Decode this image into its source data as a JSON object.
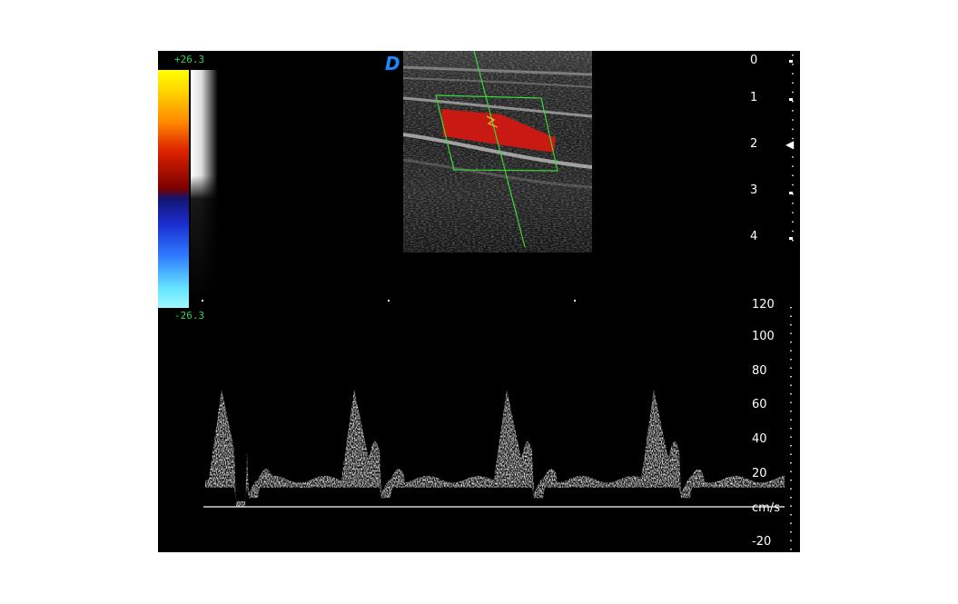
{
  "color_scale": {
    "max_label": "+26.3",
    "min_label": "-26.3"
  },
  "logo": {
    "glyph": "D",
    "color": "#1e88ff"
  },
  "depth_scale": {
    "labels": [
      "0",
      "1",
      "2",
      "3",
      "4"
    ],
    "unit_marker": "◀"
  },
  "velocity_scale": {
    "labels": [
      "120",
      "100",
      "80",
      "60",
      "40",
      "20",
      "cm/s",
      "-20"
    ]
  },
  "colors": {
    "flow": "#c81a12",
    "roi_box": "#38d838",
    "cursor": "#38d838",
    "baseline": "#ffffff"
  }
}
